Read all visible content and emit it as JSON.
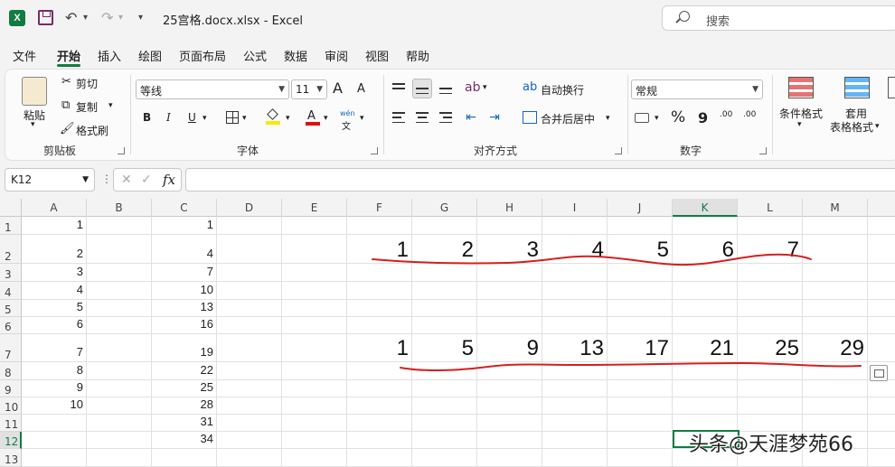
{
  "app": {
    "title": "25宫格.docx.xlsx  -  Excel",
    "search_placeholder": "搜索"
  },
  "quick_access": {
    "undo": "↶",
    "redo": "↷",
    "more": "▾"
  },
  "menu": {
    "tabs": [
      {
        "label": "文件"
      },
      {
        "label": "开始"
      },
      {
        "label": "插入"
      },
      {
        "label": "绘图"
      },
      {
        "label": "页面布局"
      },
      {
        "label": "公式"
      },
      {
        "label": "数据"
      },
      {
        "label": "审阅"
      },
      {
        "label": "视图"
      },
      {
        "label": "帮助"
      }
    ]
  },
  "ribbon": {
    "clipboard": {
      "paste": "粘贴",
      "cut": "剪切",
      "copy": "复制",
      "format_painter": "格式刷",
      "group": "剪贴板"
    },
    "font": {
      "name": "等线",
      "size": "11",
      "grow": "A",
      "shrink": "A",
      "bold": "B",
      "italic": "I",
      "underline": "U",
      "phonetic": "wén",
      "phonetic_sub": "文",
      "group": "字体"
    },
    "alignment": {
      "wrap": "自动换行",
      "merge": "合并后居中",
      "group": "对齐方式"
    },
    "number": {
      "format": "常规",
      "percent": "%",
      "comma": "9",
      "inc_dec": ".00",
      "group": "数字"
    },
    "styles": {
      "conditional": "条件格式",
      "table": "套用",
      "table2": "表格格式"
    }
  },
  "formula_bar": {
    "name_box": "K12",
    "fx": "fx",
    "cancel": "✕",
    "enter": "✓",
    "value": ""
  },
  "sheet": {
    "columns": [
      "A",
      "B",
      "C",
      "D",
      "E",
      "F",
      "G",
      "H",
      "I",
      "J",
      "K",
      "L",
      "M"
    ],
    "selected_column": "K",
    "rows": [
      "1",
      "2",
      "3",
      "4",
      "5",
      "6",
      "7",
      "8",
      "9",
      "10",
      "11",
      "12",
      "13"
    ],
    "selected_row": "12",
    "col_a": [
      "1",
      "2",
      "3",
      "4",
      "5",
      "6",
      "7",
      "8",
      "9",
      "10"
    ],
    "col_c": [
      "1",
      "4",
      "7",
      "10",
      "13",
      "16",
      "19",
      "22",
      "25",
      "28",
      "31",
      "34"
    ],
    "row2_big": [
      "1",
      "2",
      "3",
      "4",
      "5",
      "6",
      "7"
    ],
    "row7_big": [
      "1",
      "5",
      "9",
      "13",
      "17",
      "21",
      "25",
      "29"
    ]
  },
  "watermark": "头条@天涯梦苑66",
  "colors": {
    "accent": "#107c41",
    "ink": "#d42020"
  }
}
